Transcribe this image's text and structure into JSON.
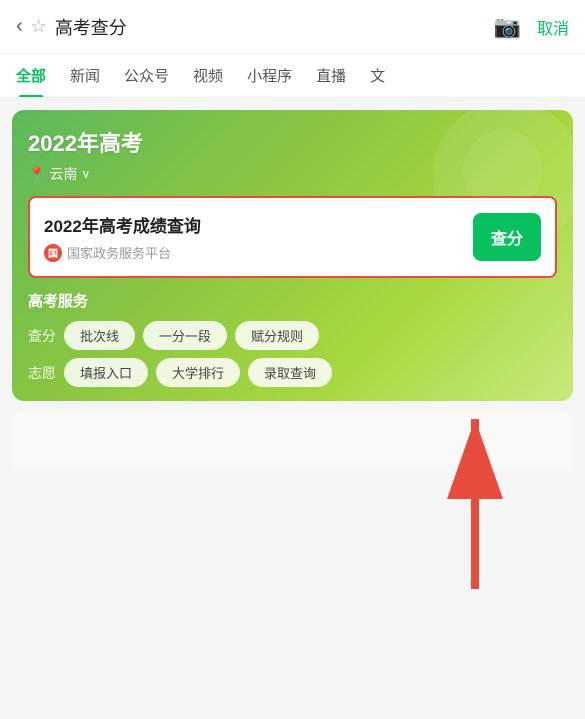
{
  "topBar": {
    "backLabel": "‹",
    "starLabel": "☆",
    "title": "高考查分",
    "cameraLabel": "📷",
    "cancelLabel": "取消"
  },
  "tabs": [
    {
      "label": "全部",
      "active": true
    },
    {
      "label": "新闻",
      "active": false
    },
    {
      "label": "公众号",
      "active": false
    },
    {
      "label": "视频",
      "active": false
    },
    {
      "label": "小程序",
      "active": false
    },
    {
      "label": "直播",
      "active": false
    },
    {
      "label": "文",
      "active": false
    }
  ],
  "banner": {
    "title": "2022年高考",
    "locationIcon": "📍",
    "location": "云南",
    "dropdownArrow": "∨"
  },
  "queryCard": {
    "title": "2022年高考成绩查询",
    "sourceIconText": "国",
    "sourceName": "国家政务服务平台",
    "buttonLabel": "查分"
  },
  "services": {
    "title": "高考服务",
    "rows": [
      {
        "label": "查分",
        "tags": [
          "批次线",
          "一分一段",
          "赋分规则"
        ]
      },
      {
        "label": "志愿",
        "tags": [
          "填报入口",
          "大学排行",
          "录取查询"
        ]
      }
    ]
  }
}
